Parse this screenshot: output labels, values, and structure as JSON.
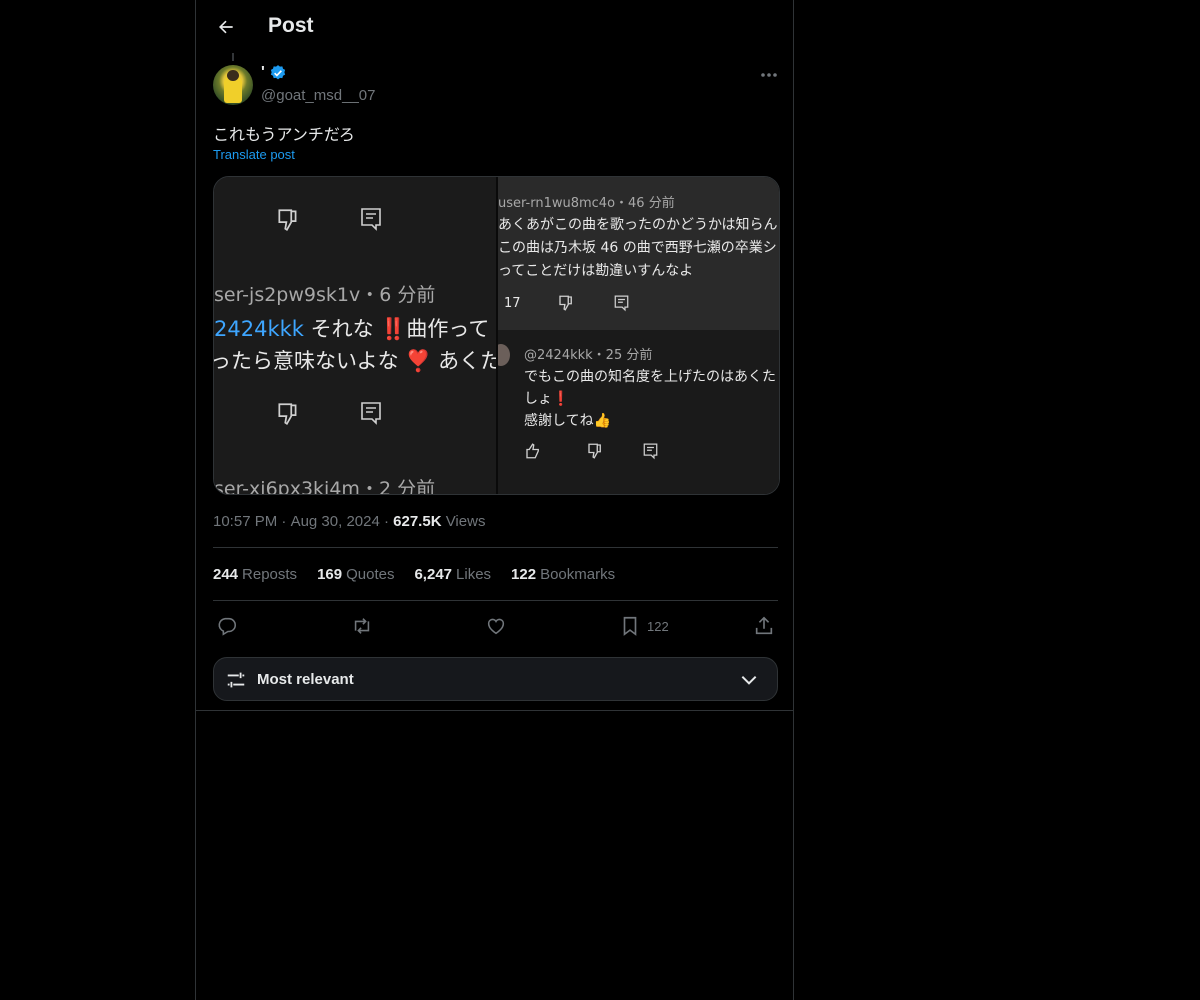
{
  "header": {
    "title": "Post"
  },
  "author": {
    "name": "'",
    "handle": "@goat_msd__07",
    "verified": true
  },
  "post": {
    "text": "これもうアンチだろ",
    "translate_label": "Translate post"
  },
  "media": {
    "left": {
      "user1": "ser-js2pw9sk1v",
      "time1": "・6 分前",
      "mention": "2424kkk",
      "line1": " それな ‼️曲作って",
      "line2": "ったら意味ないよな ❣️ あくた",
      "user2": "ser-xj6px3kj4m",
      "time2": "・2 分前"
    },
    "right": {
      "user1": "user-rn1wu8mc4o",
      "time1": "・46 分前",
      "line1": "あくあがこの曲を歌ったのかどうかは知らん",
      "line2": "この曲は乃木坂 46 の曲で西野七瀬の卒業シ",
      "line3": "ってことだけは勘違いすんなよ",
      "likes": "17",
      "user2": "@2424kkk",
      "time2": "・25 分前",
      "reply1": "でもこの曲の知名度を上げたのはあくた",
      "reply2": "しょ❗",
      "reply3": "感謝してね👍"
    }
  },
  "meta": {
    "time": "10:57 PM",
    "dot": " · ",
    "date": "Aug 30, 2024",
    "views_count": "627.5K",
    "views_label": " Views"
  },
  "stats": {
    "reposts_count": "244",
    "reposts_label": "Reposts",
    "quotes_count": "169",
    "quotes_label": "Quotes",
    "likes_count": "6,247",
    "likes_label": "Likes",
    "bookmarks_count": "122",
    "bookmarks_label": "Bookmarks"
  },
  "actions": {
    "reply_icon": "reply-icon",
    "repost_icon": "repost-icon",
    "like_icon": "heart-icon",
    "bookmark_icon": "bookmark-icon",
    "bookmark_count": "122",
    "share_icon": "share-icon"
  },
  "sort": {
    "label": "Most relevant"
  },
  "colors": {
    "accent": "#1d9bf0",
    "muted": "#71767b",
    "text": "#e7e9ea",
    "border": "#2f3336"
  }
}
